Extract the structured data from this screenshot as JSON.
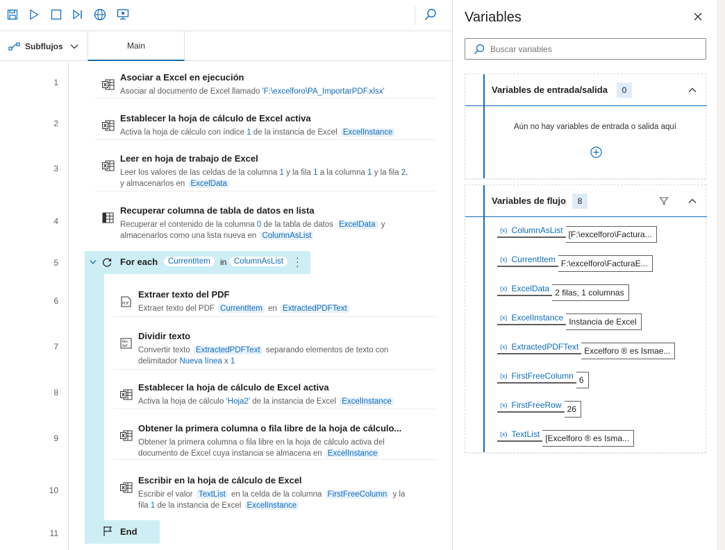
{
  "toolbar": {
    "icons": [
      "save-icon",
      "run-icon",
      "stop-icon",
      "step-icon",
      "web-recorder-icon",
      "desktop-recorder-icon",
      "search-icon"
    ]
  },
  "tabs": {
    "subflows_label": "Subflujos",
    "main_label": "Main"
  },
  "steps": [
    {
      "num": "1",
      "title": "Asociar a Excel en ejecución",
      "desc1": "Asociar al documento de Excel llamado ",
      "lit1": "'F:\\excelforo\\PA_ImportarPDF.xlsx'"
    },
    {
      "num": "2",
      "title": "Establecer la hoja de cálculo de Excel activa",
      "desc1": "Activa la hoja de cálculo con índice ",
      "lit1": "1",
      "desc2": " de la instancia de Excel ",
      "var1": "ExcelInstance"
    },
    {
      "num": "3",
      "title": "Leer en hoja de trabajo de Excel",
      "desc1": "Leer los valores de las celdas de la columna ",
      "lit1": "1",
      "desc2": " y la fila ",
      "lit2": "1",
      "desc3": " a la columna ",
      "lit3": "1",
      "desc4": " y la fila ",
      "lit4": "2",
      "desc5": ",",
      "desc6": "y almacenarlos en ",
      "var1": "ExcelData"
    },
    {
      "num": "4",
      "title": "Recuperar columna de tabla de datos en lista",
      "desc1": "Recuperar el contenido de la columna ",
      "lit1": "0",
      "desc2": " de la tabla de datos ",
      "var1": "ExcelData",
      "desc3": " y",
      "desc4": "almacenarlos como una lista nueva en ",
      "var2": "ColumnAsList"
    },
    {
      "num": "5",
      "title": "For each",
      "var1": "CurrentItem",
      "in_label": "in",
      "var2": "ColumnAsList"
    },
    {
      "num": "6",
      "title": "Extraer texto del PDF",
      "desc1": "Extraer texto del PDF ",
      "var1": "CurrentItem",
      "desc2": " en ",
      "var2": "ExtractedPDFText"
    },
    {
      "num": "7",
      "title": "Dividir texto",
      "desc1": "Convertir texto ",
      "var1": "ExtractedPDFText",
      "desc2": " separando elementos de texto con",
      "desc3": "delimitador ",
      "lit1": "Nueva línea",
      "desc4": " x ",
      "lit2": "1"
    },
    {
      "num": "8",
      "title": "Establecer la hoja de cálculo de Excel activa",
      "desc1": "Activa la hoja de cálculo ",
      "lit1": "'Hoja2'",
      "desc2": " de la instancia de Excel ",
      "var1": "ExcelInstance"
    },
    {
      "num": "9",
      "title": "Obtener la primera columna o fila libre de la hoja de cálculo...",
      "desc1": "Obtener la primera columna o fila libre en la hoja de cálculo activa del",
      "desc2": "documento de Excel cuya instancia se almacena en ",
      "var1": "ExcelInstance"
    },
    {
      "num": "10",
      "title": "Escribir en la hoja de cálculo de Excel",
      "desc1": "Escribir el valor ",
      "var1": "TextList",
      "desc2": " en la celda de la columna ",
      "var2": "FirstFreeColumn",
      "desc3": " y la",
      "desc4": "fila ",
      "lit1": "1",
      "desc5": " de la instancia de Excel ",
      "var3": "ExcelInstance"
    },
    {
      "num": "11",
      "title": "End"
    }
  ],
  "variables_pane": {
    "title": "Variables",
    "search_placeholder": "Buscar variables",
    "io_section": {
      "title": "Variables de entrada/salida",
      "count": "0",
      "empty_text": "Aún no hay variables de entrada o salida aquí"
    },
    "flow_section": {
      "title": "Variables de flujo",
      "count": "8",
      "items": [
        {
          "name": "ColumnAsList",
          "value": "[F:\\excelforo\\Factura..."
        },
        {
          "name": "CurrentItem",
          "value": "F:\\excelforo\\FacturaE..."
        },
        {
          "name": "ExcelData",
          "value": "2 filas, 1 columnas"
        },
        {
          "name": "ExcelInstance",
          "value": "Instancia de Excel"
        },
        {
          "name": "ExtractedPDFText",
          "value": "Excelforo ® es Ismae..."
        },
        {
          "name": "FirstFreeColumn",
          "value": "6"
        },
        {
          "name": "FirstFreeRow",
          "value": "26"
        },
        {
          "name": "TextList",
          "value": "[Excelforo ® es Isma..."
        }
      ]
    }
  },
  "colors": {
    "accent": "#0f6cbd",
    "loop_highlight": "#cdeef5",
    "count_badge": "#deecf9"
  }
}
